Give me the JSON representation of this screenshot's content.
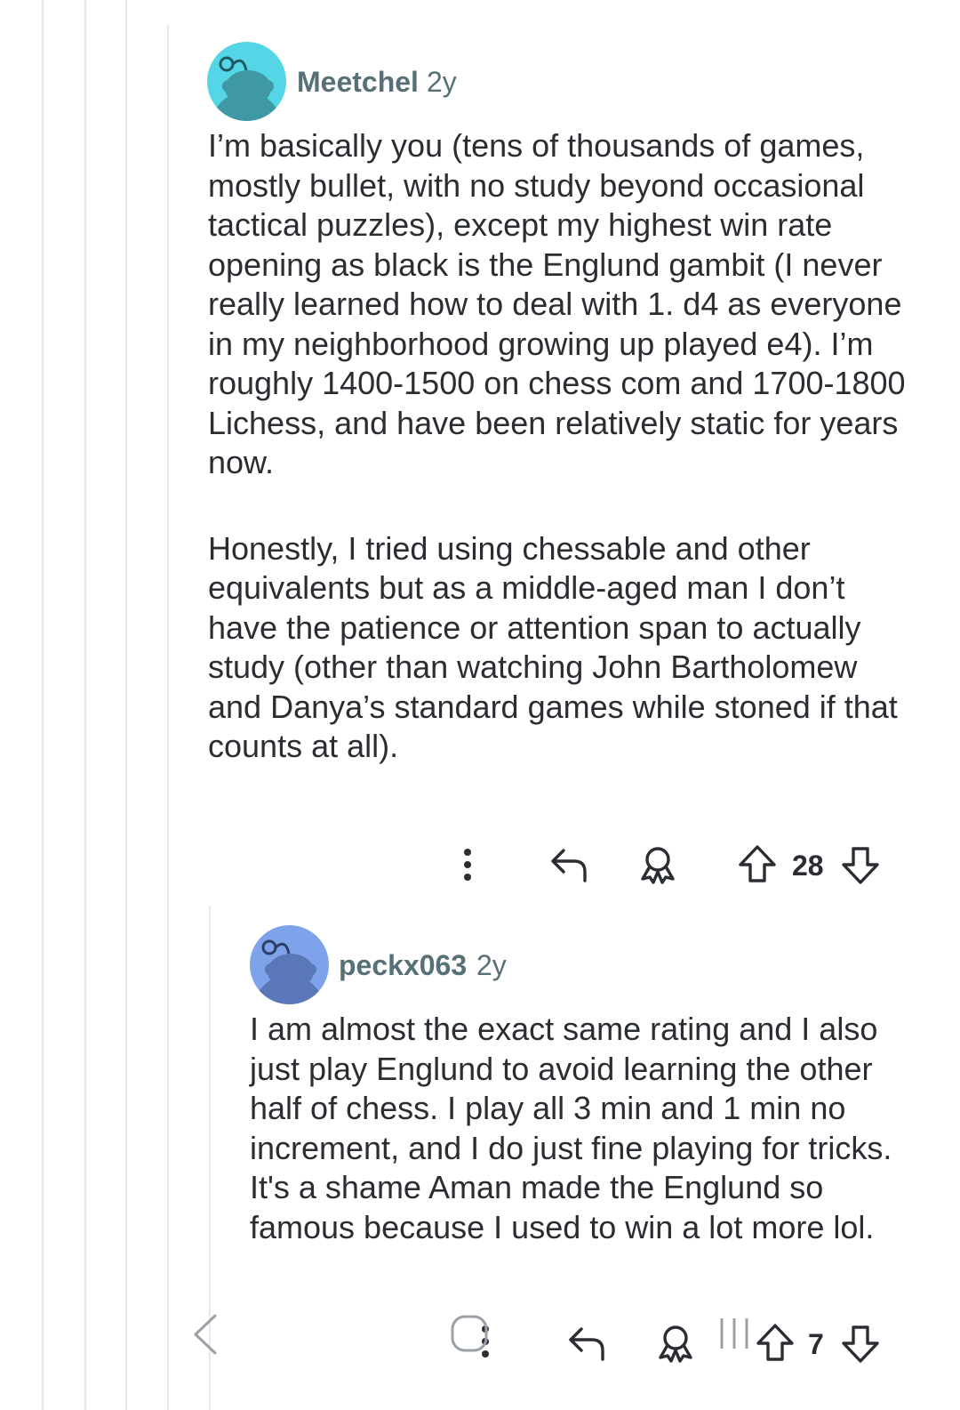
{
  "thread": {
    "comments": [
      {
        "username": "Meetchel",
        "age": "2y",
        "avatar_icon": "snoo-avatar-icon",
        "avatar_color": "#55d6e6",
        "paragraphs": [
          "I’m basically you (tens of thousands of games, mostly bullet, with no study beyond occasional tactical puzzles), except my highest win rate opening as black is the Englund gambit (I never really learned how to deal with 1. d4 as everyone in my neighborhood growing up played e4). I’m roughly 1400-1500 on chess com and 1700-1800 Lichess, and have been relatively static for years now.",
          "Honestly, I tried using chessable and other equivalents but as a middle-aged man I don’t have the patience or attention span to actually study (other than watching John Bartholomew and Danya’s standard games while stoned if that counts at all)."
        ],
        "score": "28",
        "actions": [
          "more-options-icon",
          "reply-icon",
          "award-icon",
          "upvote-icon",
          "downvote-icon"
        ]
      },
      {
        "username": "peckx063",
        "age": "2y",
        "avatar_icon": "snoo-avatar-icon",
        "avatar_color": "#7fa3ea",
        "paragraphs": [
          "I am almost the exact same rating and I also just play Englund to avoid learning the other half of chess. I play all 3 min and 1 min no increment, and I do just fine playing for tricks. It's a shame Aman made the Englund so famous because I used to win a lot more lol."
        ],
        "score": "7",
        "actions": [
          "more-options-icon",
          "reply-icon",
          "award-icon",
          "upvote-icon",
          "downvote-icon"
        ]
      }
    ]
  },
  "system_nav": {
    "icons": [
      "back-nav-icon",
      "home-nav-icon",
      "recents-nav-icon"
    ]
  },
  "colors": {
    "text": "#2a2d31",
    "meta": "#576f76",
    "thread_line": "#e6e8eb"
  }
}
